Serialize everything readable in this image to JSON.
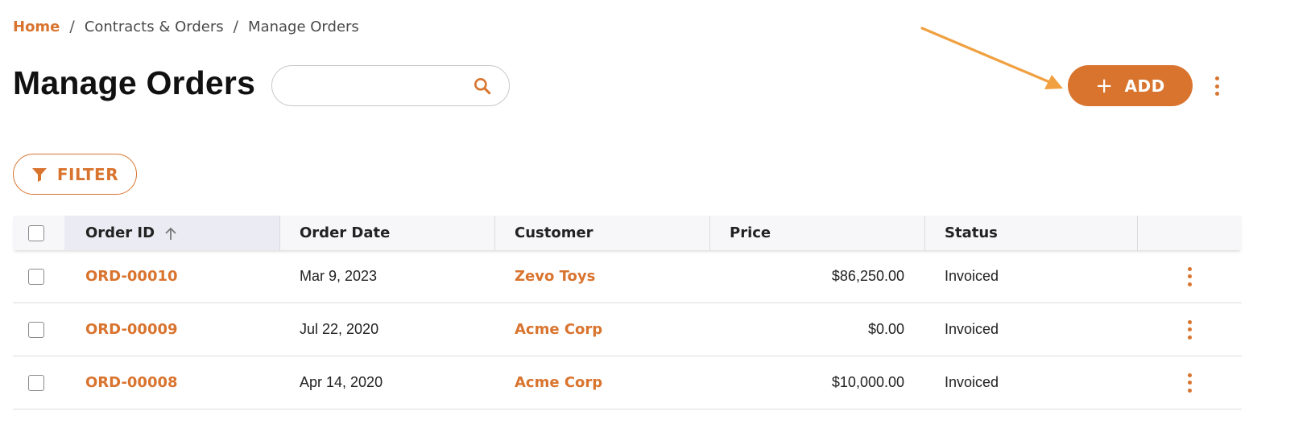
{
  "breadcrumb": {
    "items": [
      "Home",
      "Contracts & Orders",
      "Manage Orders"
    ],
    "separator": "/"
  },
  "page": {
    "title": "Manage Orders"
  },
  "search": {
    "placeholder": "",
    "value": "",
    "icon": "search-icon"
  },
  "toolbar": {
    "add_label": "ADD",
    "add_icon": "plus-icon",
    "more_icon": "more-vertical-icon"
  },
  "filter": {
    "label": "FILTER",
    "icon": "filter-icon"
  },
  "table": {
    "columns": [
      "Order ID",
      "Order Date",
      "Customer",
      "Price",
      "Status"
    ],
    "sorted_column": "Order ID",
    "sort_direction": "ascending",
    "rows": [
      {
        "id": "ORD-00010",
        "date": "Mar 9, 2023",
        "customer": "Zevo Toys",
        "price": "$86,250.00",
        "status": "Invoiced"
      },
      {
        "id": "ORD-00009",
        "date": "Jul 22, 2020",
        "customer": "Acme Corp",
        "price": "$0.00",
        "status": "Invoiced"
      },
      {
        "id": "ORD-00008",
        "date": "Apr 14, 2020",
        "customer": "Acme Corp",
        "price": "$10,000.00",
        "status": "Invoiced"
      }
    ]
  },
  "colors": {
    "accent": "#d9742f",
    "annotation_arrow": "#f0a040",
    "header_bg": "#f7f7f9",
    "sorted_header_bg": "#ebebf3"
  }
}
